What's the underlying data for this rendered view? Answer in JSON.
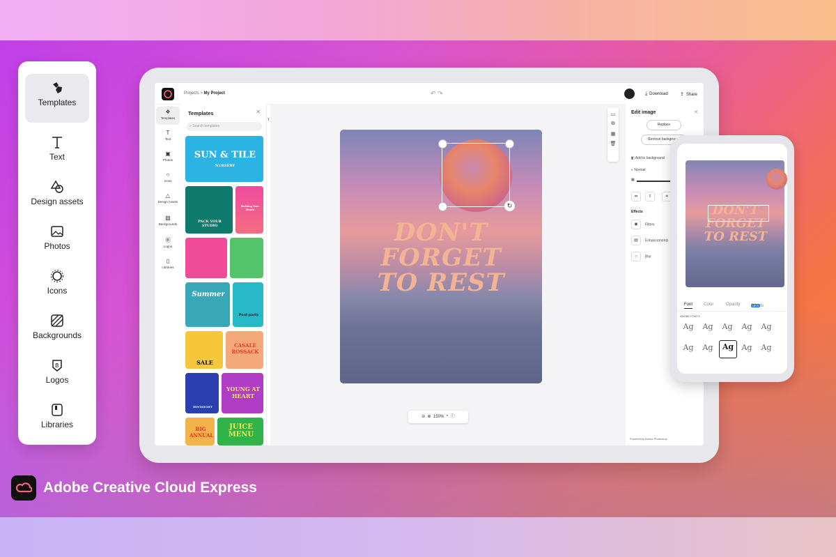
{
  "left_rail": {
    "items": [
      {
        "label": "Templates",
        "icon": "templates-icon"
      },
      {
        "label": "Text",
        "icon": "text-icon"
      },
      {
        "label": "Design assets",
        "icon": "design-assets-icon"
      },
      {
        "label": "Photos",
        "icon": "photos-icon"
      },
      {
        "label": "Icons",
        "icon": "icons-icon"
      },
      {
        "label": "Backgrounds",
        "icon": "backgrounds-icon"
      },
      {
        "label": "Logos",
        "icon": "logos-icon"
      },
      {
        "label": "Libraries",
        "icon": "libraries-icon"
      }
    ]
  },
  "brand": {
    "name": "Adobe Creative Cloud Express"
  },
  "app": {
    "breadcrumb": {
      "parent": "Projects",
      "separator": ">",
      "current": "My Project"
    },
    "undo_glyphs": "↶ ↷",
    "toolbar": {
      "download": "Download",
      "share": "Share"
    },
    "side_rail": [
      "Templates",
      "Text",
      "Photos",
      "Icons",
      "Design Assets",
      "Backgrounds",
      "Logos",
      "Libraries"
    ],
    "templates_panel": {
      "title": "Templates",
      "search_placeholder": "Search templates",
      "thumbs": {
        "sun_tile": "SUN & TILE",
        "sun_tile_sub": "NURSERY",
        "pack_your_studio": "PACK YOUR STUDIO",
        "building_brand": "Building Your Brand",
        "summer": "Summer",
        "pool_party": "Pool party",
        "casale_rossack": "CASALE ROSSACK",
        "sale": "SALE",
        "hindsight": "HINDSIGHT",
        "young_at_heart": "YOUNG AT HEART",
        "big_annual": "BIG ANNUAL",
        "juice_menu": "JUICE MENU"
      }
    },
    "canvas": {
      "headline": [
        "DON'T",
        "FORGET",
        "TO REST"
      ],
      "zoom": "150%"
    },
    "right_panel": {
      "title": "Edit image",
      "replace": "Replace",
      "remove_background": "Remove background",
      "add_to_background": "Add to background",
      "blend": "Normal",
      "effects_title": "Effects",
      "filters": "Filters",
      "enhancements": "Enhancements",
      "blur": "Blur",
      "powered_by": "Powered by Adobe Photoshop"
    }
  },
  "phone": {
    "headline": [
      "DON'T",
      "FORGET",
      "TO REST"
    ],
    "tabs": {
      "font": "Font",
      "color": "Color",
      "opacity": "Opacity",
      "effects": "Effects",
      "new_badge": "NEW"
    },
    "fonts_label": "ADOBE FONTS",
    "font_tile": "Ag"
  },
  "colors": {
    "accent": "#1473e6",
    "headline": "#f3b395",
    "rail_active": "#e9e9ee"
  }
}
